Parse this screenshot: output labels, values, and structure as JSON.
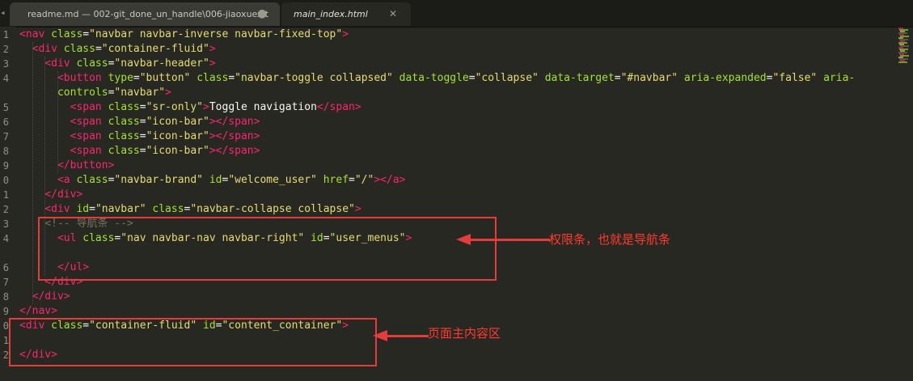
{
  "tabs": [
    {
      "label": "readme.md — 002-git_done_un_handle\\006-jiaoxuexit",
      "state": "modified",
      "modified_glyph": "●"
    },
    {
      "label": "main_index.html",
      "state": "active",
      "close_glyph": "✕"
    }
  ],
  "line_numbers": [
    "1",
    "2",
    "3",
    "4",
    "",
    "5",
    "6",
    "7",
    "8",
    "9",
    "0",
    "1",
    "2",
    "3",
    "4",
    "",
    "6",
    "7",
    "8",
    "9",
    "0",
    "1",
    "2"
  ],
  "code_lines": [
    [
      [
        "tg",
        "<"
      ],
      [
        "tg",
        "nav"
      ],
      [
        "tx",
        " "
      ],
      [
        "at",
        "class"
      ],
      [
        "tx",
        "="
      ],
      [
        "st",
        "\"navbar navbar-inverse navbar-fixed-top\""
      ],
      [
        "tg",
        ">"
      ]
    ],
    [
      [
        "tx",
        "  "
      ],
      [
        "tg",
        "<div"
      ],
      [
        "tx",
        " "
      ],
      [
        "at",
        "class"
      ],
      [
        "tx",
        "="
      ],
      [
        "st",
        "\"container-fluid\""
      ],
      [
        "tg",
        ">"
      ]
    ],
    [
      [
        "tx",
        "    "
      ],
      [
        "tg",
        "<div"
      ],
      [
        "tx",
        " "
      ],
      [
        "at",
        "class"
      ],
      [
        "tx",
        "="
      ],
      [
        "st",
        "\"navbar-header\""
      ],
      [
        "tg",
        ">"
      ]
    ],
    [
      [
        "tx",
        "      "
      ],
      [
        "tg",
        "<button"
      ],
      [
        "tx",
        " "
      ],
      [
        "at",
        "type"
      ],
      [
        "tx",
        "="
      ],
      [
        "st",
        "\"button\""
      ],
      [
        "tx",
        " "
      ],
      [
        "at",
        "class"
      ],
      [
        "tx",
        "="
      ],
      [
        "st",
        "\"navbar-toggle collapsed\""
      ],
      [
        "tx",
        " "
      ],
      [
        "at",
        "data-toggle"
      ],
      [
        "tx",
        "="
      ],
      [
        "st",
        "\"collapse\""
      ],
      [
        "tx",
        " "
      ],
      [
        "at",
        "data-target"
      ],
      [
        "tx",
        "="
      ],
      [
        "st",
        "\"#navbar\""
      ],
      [
        "tx",
        " "
      ],
      [
        "at",
        "aria-expanded"
      ],
      [
        "tx",
        "="
      ],
      [
        "st",
        "\"false\""
      ],
      [
        "tx",
        " "
      ],
      [
        "at",
        "aria-"
      ]
    ],
    [
      [
        "tx",
        "      "
      ],
      [
        "at",
        "controls"
      ],
      [
        "tx",
        "="
      ],
      [
        "st",
        "\"navbar\""
      ],
      [
        "tg",
        ">"
      ]
    ],
    [
      [
        "tx",
        "        "
      ],
      [
        "tg",
        "<span"
      ],
      [
        "tx",
        " "
      ],
      [
        "at",
        "class"
      ],
      [
        "tx",
        "="
      ],
      [
        "st",
        "\"sr-only\""
      ],
      [
        "tg",
        ">"
      ],
      [
        "tx",
        "Toggle navigation"
      ],
      [
        "tg",
        "</span"
      ],
      [
        "tg",
        ">"
      ]
    ],
    [
      [
        "tx",
        "        "
      ],
      [
        "tg",
        "<span"
      ],
      [
        "tx",
        " "
      ],
      [
        "at",
        "class"
      ],
      [
        "tx",
        "="
      ],
      [
        "st",
        "\"icon-bar\""
      ],
      [
        "tg",
        ">"
      ],
      [
        "tg",
        "</span"
      ],
      [
        "tg",
        ">"
      ]
    ],
    [
      [
        "tx",
        "        "
      ],
      [
        "tg",
        "<span"
      ],
      [
        "tx",
        " "
      ],
      [
        "at",
        "class"
      ],
      [
        "tx",
        "="
      ],
      [
        "st",
        "\"icon-bar\""
      ],
      [
        "tg",
        ">"
      ],
      [
        "tg",
        "</span"
      ],
      [
        "tg",
        ">"
      ]
    ],
    [
      [
        "tx",
        "        "
      ],
      [
        "tg",
        "<span"
      ],
      [
        "tx",
        " "
      ],
      [
        "at",
        "class"
      ],
      [
        "tx",
        "="
      ],
      [
        "st",
        "\"icon-bar\""
      ],
      [
        "tg",
        ">"
      ],
      [
        "tg",
        "</span"
      ],
      [
        "tg",
        ">"
      ]
    ],
    [
      [
        "tx",
        "      "
      ],
      [
        "tg",
        "</button"
      ],
      [
        "tg",
        ">"
      ]
    ],
    [
      [
        "tx",
        "      "
      ],
      [
        "tg",
        "<a"
      ],
      [
        "tx",
        " "
      ],
      [
        "at",
        "class"
      ],
      [
        "tx",
        "="
      ],
      [
        "st",
        "\"navbar-brand\""
      ],
      [
        "tx",
        " "
      ],
      [
        "at",
        "id"
      ],
      [
        "tx",
        "="
      ],
      [
        "st",
        "\"welcome_user\""
      ],
      [
        "tx",
        " "
      ],
      [
        "at",
        "href"
      ],
      [
        "tx",
        "="
      ],
      [
        "st",
        "\"/\""
      ],
      [
        "tg",
        ">"
      ],
      [
        "tg",
        "</a"
      ],
      [
        "tg",
        ">"
      ]
    ],
    [
      [
        "tx",
        "    "
      ],
      [
        "tg",
        "</div"
      ],
      [
        "tg",
        ">"
      ]
    ],
    [
      [
        "tx",
        "    "
      ],
      [
        "tg",
        "<div"
      ],
      [
        "tx",
        " "
      ],
      [
        "at",
        "id"
      ],
      [
        "tx",
        "="
      ],
      [
        "st",
        "\"navbar\""
      ],
      [
        "tx",
        " "
      ],
      [
        "at",
        "class"
      ],
      [
        "tx",
        "="
      ],
      [
        "st",
        "\"navbar-collapse collapse\""
      ],
      [
        "tg",
        ">"
      ]
    ],
    [
      [
        "tx",
        "    "
      ],
      [
        "cm",
        "<!-- 导航条 -->"
      ]
    ],
    [
      [
        "tx",
        "      "
      ],
      [
        "tg",
        "<ul"
      ],
      [
        "tx",
        " "
      ],
      [
        "at",
        "class"
      ],
      [
        "tx",
        "="
      ],
      [
        "st",
        "\"nav navbar-nav navbar-right\""
      ],
      [
        "tx",
        " "
      ],
      [
        "at",
        "id"
      ],
      [
        "tx",
        "="
      ],
      [
        "st",
        "\"user_menus\""
      ],
      [
        "tg",
        ">"
      ]
    ],
    [],
    [
      [
        "tx",
        "      "
      ],
      [
        "tg",
        "</ul"
      ],
      [
        "tg",
        ">"
      ]
    ],
    [
      [
        "tx",
        "    "
      ],
      [
        "tg",
        "</div"
      ],
      [
        "tg",
        ">"
      ]
    ],
    [
      [
        "tx",
        "  "
      ],
      [
        "tg",
        "</div"
      ],
      [
        "tg",
        ">"
      ]
    ],
    [
      [
        "tg",
        "</"
      ],
      [
        "tg",
        "nav"
      ],
      [
        "tg",
        ">"
      ]
    ],
    [
      [
        "tg",
        "<div"
      ],
      [
        "tx",
        " "
      ],
      [
        "at",
        "class"
      ],
      [
        "tx",
        "="
      ],
      [
        "st",
        "\"container-fluid\""
      ],
      [
        "tx",
        " "
      ],
      [
        "at",
        "id"
      ],
      [
        "tx",
        "="
      ],
      [
        "st",
        "\"content_container\""
      ],
      [
        "tg",
        ">"
      ]
    ],
    [],
    [
      [
        "tg",
        "</div"
      ],
      [
        "tg",
        ">"
      ]
    ]
  ],
  "annotations": {
    "nav_box_label": "权限条，也就是导航条",
    "content_box_label": "页面主内容区"
  },
  "colors": {
    "background": "#272822",
    "tag": "#f92672",
    "attribute": "#a6e22e",
    "string": "#e6db74",
    "text": "#f8f8f2",
    "comment": "#75715e",
    "annotation": "#e63b3b"
  },
  "icons": {
    "tab_modified": "dot-icon",
    "tab_close": "close-icon",
    "tab_scroll": "play-left-icon"
  }
}
